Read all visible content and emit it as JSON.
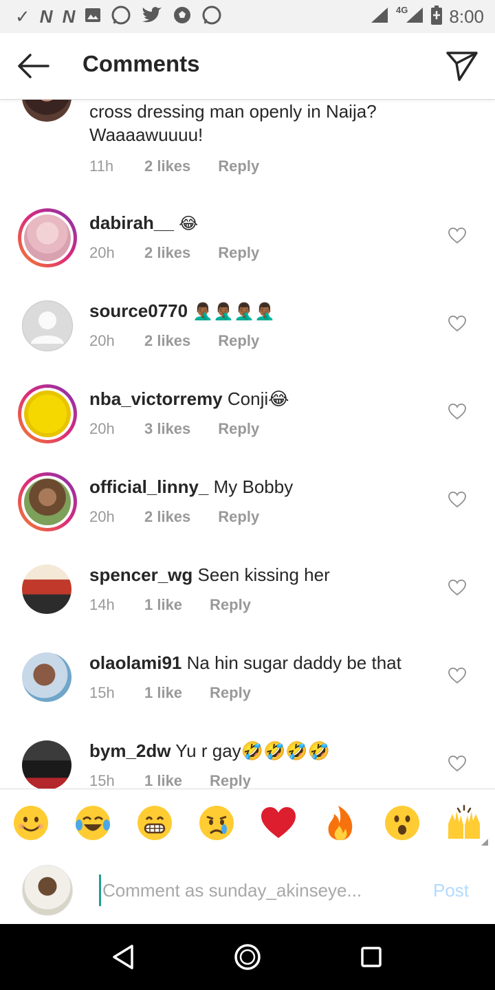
{
  "status_bar": {
    "icons": [
      "check-icon",
      "n-icon",
      "n-icon",
      "gallery-icon",
      "whatsapp-icon",
      "twitter-icon",
      "soccer-icon",
      "whatsapp-icon"
    ],
    "network": "4G",
    "time": "8:00"
  },
  "header": {
    "title": "Comments"
  },
  "comments": [
    {
      "username": "",
      "text": "cross dressing man openly in Naija?",
      "text2": "Waaaawuuuu!",
      "time": "11h",
      "likes": "2 likes",
      "reply": "Reply"
    },
    {
      "username": "dabirah__",
      "text": "😂",
      "time": "20h",
      "likes": "2 likes",
      "reply": "Reply"
    },
    {
      "username": "source0770",
      "text": "🤦🏾‍♂️🤦🏾‍♂️🤦🏾‍♂️🤦🏾‍♂️",
      "time": "20h",
      "likes": "2 likes",
      "reply": "Reply"
    },
    {
      "username": "nba_victorremy",
      "text": "Conji😂",
      "time": "20h",
      "likes": "3 likes",
      "reply": "Reply"
    },
    {
      "username": "official_linny_",
      "text": "My Bobby",
      "time": "20h",
      "likes": "2 likes",
      "reply": "Reply"
    },
    {
      "username": "spencer_wg",
      "text": "Seen kissing her",
      "time": "14h",
      "likes": "1 like",
      "reply": "Reply"
    },
    {
      "username": "olaolami91",
      "text": "Na hin sugar daddy be that",
      "time": "15h",
      "likes": "1 like",
      "reply": "Reply"
    },
    {
      "username": "bym_2dw",
      "text": "Yu r gay🤣🤣🤣🤣",
      "time": "15h",
      "likes": "1 like",
      "reply": "Reply"
    }
  ],
  "emoji_bar": [
    "😊",
    "😂",
    "😁",
    "😢",
    "❤️",
    "🔥",
    "😮",
    "🙌"
  ],
  "composer": {
    "placeholder": "Comment as sunday_akinseye...",
    "post_label": "Post"
  },
  "colors": {
    "text": "#262626",
    "meta": "#999999",
    "post_disabled": "#b3dbff",
    "cursor": "#1f9e8e",
    "story_ring": "#dd2a7b"
  }
}
